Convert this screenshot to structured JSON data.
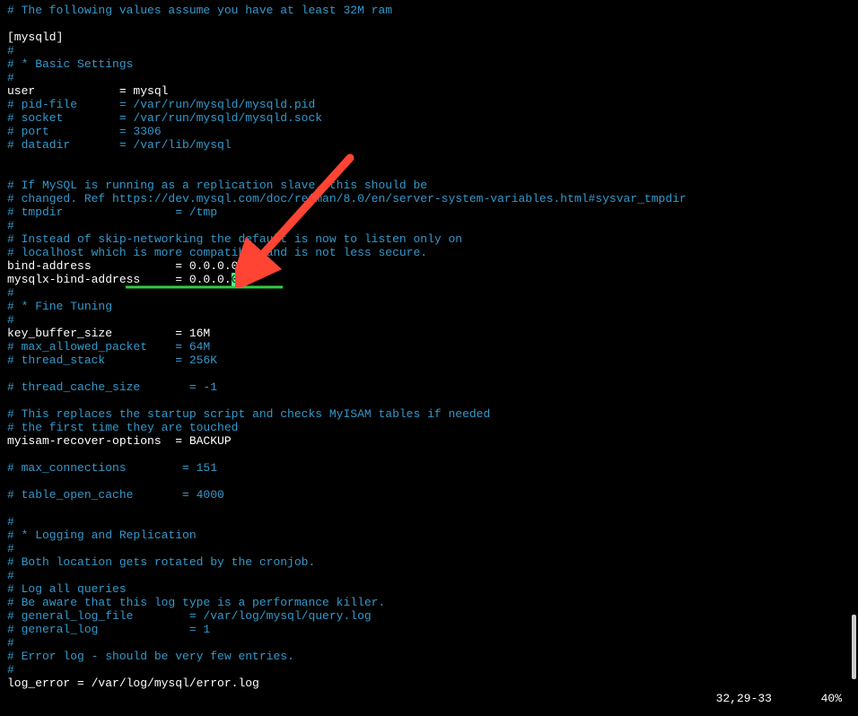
{
  "lines": [
    {
      "type": "comment",
      "text": "# The following values assume you have at least 32M ram"
    },
    {
      "type": "blank",
      "text": ""
    },
    {
      "type": "normal",
      "text": "[mysqld]"
    },
    {
      "type": "comment",
      "text": "#"
    },
    {
      "type": "comment",
      "text": "# * Basic Settings"
    },
    {
      "type": "comment",
      "text": "#"
    },
    {
      "type": "normal",
      "text": "user            = mysql"
    },
    {
      "type": "comment",
      "text": "# pid-file      = /var/run/mysqld/mysqld.pid"
    },
    {
      "type": "comment",
      "text": "# socket        = /var/run/mysqld/mysqld.sock"
    },
    {
      "type": "comment",
      "text": "# port          = 3306"
    },
    {
      "type": "comment",
      "text": "# datadir       = /var/lib/mysql"
    },
    {
      "type": "blank",
      "text": ""
    },
    {
      "type": "blank",
      "text": ""
    },
    {
      "type": "comment",
      "text": "# If MySQL is running as a replication slave, this should be"
    },
    {
      "type": "comment",
      "text": "# changed. Ref https://dev.mysql.com/doc/refman/8.0/en/server-system-variables.html#sysvar_tmpdir"
    },
    {
      "type": "comment",
      "text": "# tmpdir                = /tmp"
    },
    {
      "type": "comment",
      "text": "#"
    },
    {
      "type": "comment",
      "text": "# Instead of skip-networking the default is now to listen only on"
    },
    {
      "type": "comment",
      "text": "# localhost which is more compatible and is not less secure."
    },
    {
      "type": "normal",
      "text": "bind-address            = 0.0.0.0"
    },
    {
      "type": "cursor-line",
      "prefix": "mysqlx-bind-address     = 0.0.0.",
      "cursor": "0"
    },
    {
      "type": "comment",
      "text": "#"
    },
    {
      "type": "comment",
      "text": "# * Fine Tuning"
    },
    {
      "type": "comment",
      "text": "#"
    },
    {
      "type": "normal",
      "text": "key_buffer_size         = 16M"
    },
    {
      "type": "comment",
      "text": "# max_allowed_packet    = 64M"
    },
    {
      "type": "comment",
      "text": "# thread_stack          = 256K"
    },
    {
      "type": "blank",
      "text": ""
    },
    {
      "type": "comment",
      "text": "# thread_cache_size       = -1"
    },
    {
      "type": "blank",
      "text": ""
    },
    {
      "type": "comment",
      "text": "# This replaces the startup script and checks MyISAM tables if needed"
    },
    {
      "type": "comment",
      "text": "# the first time they are touched"
    },
    {
      "type": "normal",
      "text": "myisam-recover-options  = BACKUP"
    },
    {
      "type": "blank",
      "text": ""
    },
    {
      "type": "comment",
      "text": "# max_connections        = 151"
    },
    {
      "type": "blank",
      "text": ""
    },
    {
      "type": "comment",
      "text": "# table_open_cache       = 4000"
    },
    {
      "type": "blank",
      "text": ""
    },
    {
      "type": "comment",
      "text": "#"
    },
    {
      "type": "comment",
      "text": "# * Logging and Replication"
    },
    {
      "type": "comment",
      "text": "#"
    },
    {
      "type": "comment",
      "text": "# Both location gets rotated by the cronjob."
    },
    {
      "type": "comment",
      "text": "#"
    },
    {
      "type": "comment",
      "text": "# Log all queries"
    },
    {
      "type": "comment",
      "text": "# Be aware that this log type is a performance killer."
    },
    {
      "type": "comment",
      "text": "# general_log_file        = /var/log/mysql/query.log"
    },
    {
      "type": "comment",
      "text": "# general_log             = 1"
    },
    {
      "type": "comment",
      "text": "#"
    },
    {
      "type": "comment",
      "text": "# Error log - should be very few entries."
    },
    {
      "type": "comment",
      "text": "#"
    },
    {
      "type": "normal",
      "text": "log_error = /var/log/mysql/error.log"
    }
  ],
  "status": {
    "position": "32,29-33",
    "percent": "40%"
  },
  "annotations": {
    "arrow_color": "#ff4433",
    "underline_color": "#33cc44"
  }
}
